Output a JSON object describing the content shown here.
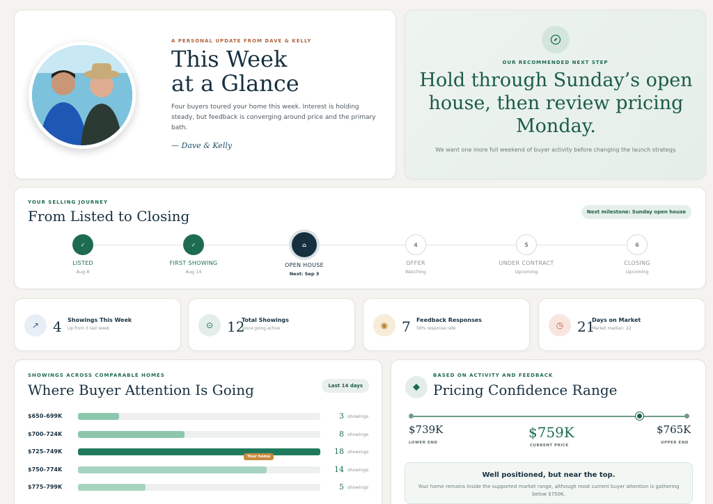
{
  "hero": {
    "eyebrow": "A PERSONAL UPDATE FROM DAVE & KELLY",
    "title_line1": "This Week",
    "title_line2": "at a Glance",
    "body": "Four buyers toured your home this week. Interest is holding steady, but feedback is converging around price and the primary bath.",
    "signature": "— Dave & Kelly"
  },
  "recommendation": {
    "icon": "compass-icon",
    "eyebrow": "OUR RECOMMENDED NEXT STEP",
    "title": "Hold through Sunday’s open house, then review pricing Monday.",
    "body": "We want one more full weekend of buyer activity before changing the launch strategy."
  },
  "journey": {
    "eyebrow": "YOUR SELLING JOURNEY",
    "title": "From Listed to Closing",
    "milestone": "Next milestone: Sunday open house",
    "steps": [
      {
        "mark": "✓",
        "label": "LISTED",
        "sub": "Aug 8",
        "state": "done"
      },
      {
        "mark": "✓",
        "label": "FIRST SHOWING",
        "sub": "Aug 14",
        "state": "done"
      },
      {
        "mark": "⌂",
        "label": "OPEN HOUSE",
        "sub": "Next: Sep 3",
        "state": "current"
      },
      {
        "mark": "4",
        "label": "OFFER",
        "sub": "Watching",
        "state": "future"
      },
      {
        "mark": "5",
        "label": "UNDER CONTRACT",
        "sub": "Upcoming",
        "state": "future"
      },
      {
        "mark": "6",
        "label": "CLOSING",
        "sub": "Upcoming",
        "state": "future"
      }
    ]
  },
  "stats": [
    {
      "icon": "trend-up-icon",
      "glyph": "↗",
      "value": "4",
      "label": "Showings This Week",
      "sub": "Up from 3 last week",
      "color": "#e7eef6",
      "ink": "#2f5f93"
    },
    {
      "icon": "target-icon",
      "glyph": "⊙",
      "value": "12",
      "label": "Total Showings",
      "sub": "Since going active",
      "color": "#e3eee8",
      "ink": "#1d6b52"
    },
    {
      "icon": "chat-icon",
      "glyph": "◉",
      "value": "7",
      "label": "Feedback Responses",
      "sub": "58% response rate",
      "color": "#f6ecd8",
      "ink": "#b7812f"
    },
    {
      "icon": "clock-icon",
      "glyph": "◷",
      "value": "21",
      "label": "Days on Market",
      "sub": "Market median: 22",
      "color": "#f7e6e0",
      "ink": "#c0573e"
    }
  ],
  "attention": {
    "eyebrow": "SHOWINGS ACROSS COMPARABLE HOMES",
    "title": "Where Buyer Attention Is Going",
    "period": "Last 14 days",
    "unit": "showings",
    "your_home_label": "Your home",
    "rows": [
      {
        "label": "$650–699K",
        "count": 3,
        "display": "3",
        "fraction": 0.17,
        "color": "#8cc7ad",
        "yours": false
      },
      {
        "label": "$700–724K",
        "count": 8,
        "display": "8",
        "fraction": 0.44,
        "color": "#8cc7ad",
        "yours": false
      },
      {
        "label": "$725–749K",
        "count": 18,
        "display": "18",
        "fraction": 1.0,
        "color": "#1f7a5c",
        "yours": false
      },
      {
        "label": "$750–774K",
        "count": 14,
        "display": "14",
        "fraction": 0.78,
        "color": "#a6d4c0",
        "yours": true
      },
      {
        "label": "$775–799K",
        "count": 5,
        "display": "5",
        "fraction": 0.28,
        "color": "#a6d4c0",
        "yours": false
      }
    ]
  },
  "pricing": {
    "icon": "diamond-icon",
    "eyebrow": "BASED ON ACTIVITY AND FEEDBACK",
    "title": "Pricing Confidence Range",
    "lower": {
      "value": "$739K",
      "label": "LOWER END"
    },
    "current": {
      "value": "$759K",
      "label": "CURRENT PRICE"
    },
    "upper": {
      "value": "$765K",
      "label": "UPPER END"
    },
    "current_fraction": 0.83,
    "note_title": "Well positioned, but near the top.",
    "note_body": "Your home remains inside the supported market range, although most current buyer attention is gathering below $750K."
  },
  "colors": {
    "brand_green": "#1d6b52",
    "navy": "#17303f",
    "accent_orange": "#b0643e"
  }
}
